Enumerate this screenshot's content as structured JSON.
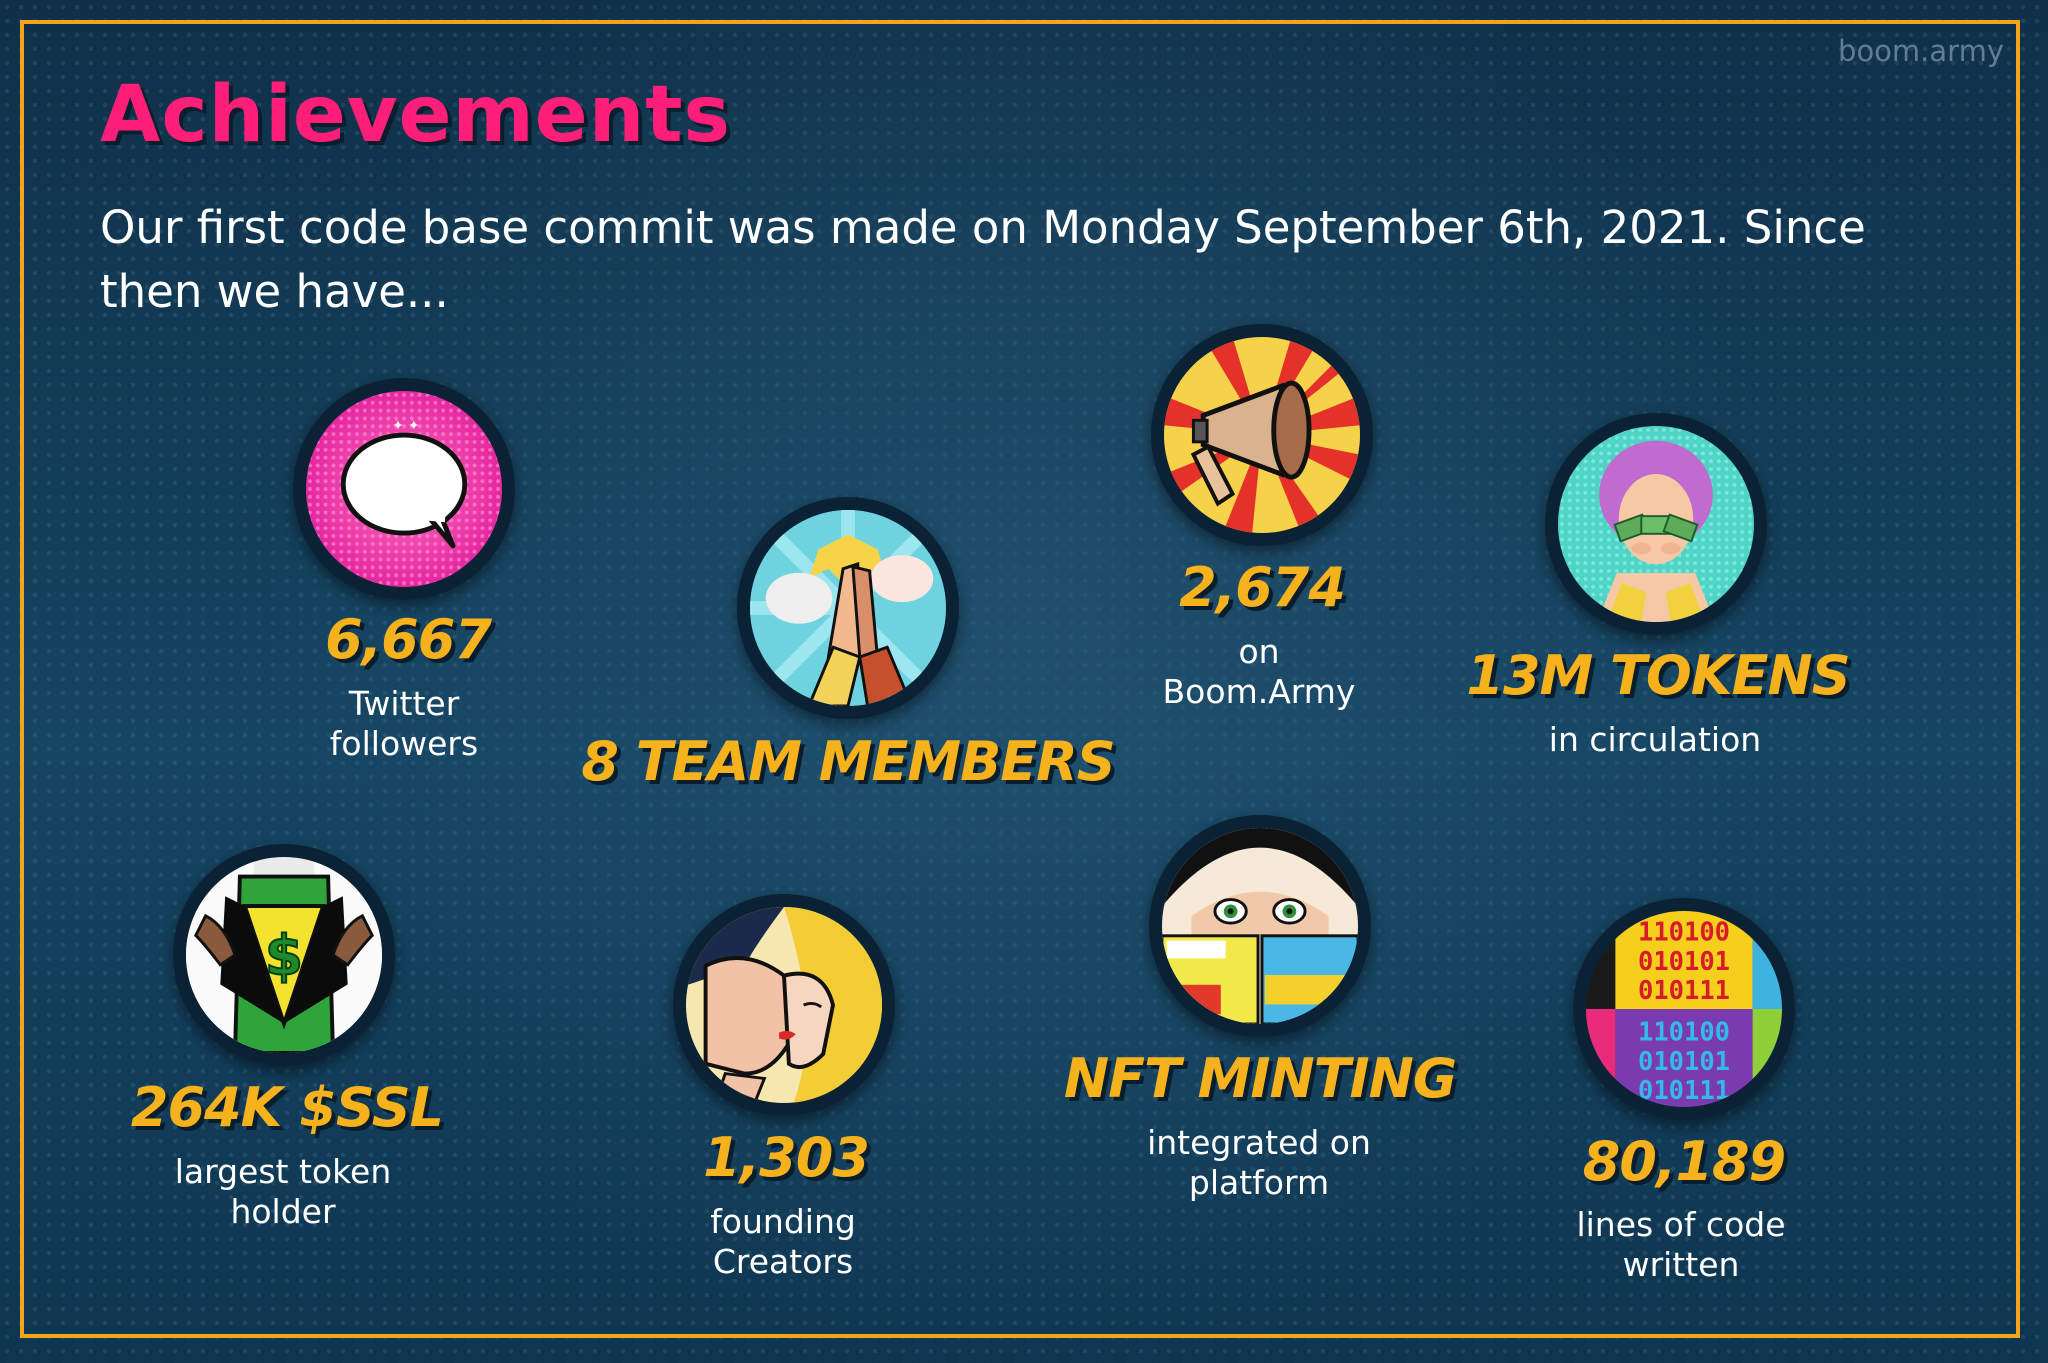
{
  "site": "boom.army",
  "title": "Achievements",
  "intro": "Our first code base commit was made on Monday September 6th, 2021. Since then we have...",
  "colors": {
    "accent_pink": "#ff1f78",
    "accent_gold": "#f6b21d",
    "frame": "#f2a41c",
    "background": "#0e2d44"
  },
  "achievements": [
    {
      "icon": "speech-bubble-icon",
      "value": "6,667",
      "label_1": "Twitter",
      "label_2": "followers"
    },
    {
      "icon": "high-five-icon",
      "value": "8 TEAM MEMBERS"
    },
    {
      "icon": "megaphone-icon",
      "value": "2,674",
      "label_1": "on",
      "label_2": "Boom.Army"
    },
    {
      "icon": "money-woman-icon",
      "value": "13M TOKENS",
      "label_1": "in circulation"
    },
    {
      "icon": "dollar-shirt-icon",
      "value": "264K $SSL",
      "label_1": "largest token",
      "label_2": "holder"
    },
    {
      "icon": "kissing-couple-icon",
      "value": "1,303",
      "label_1": "founding",
      "label_2": "Creators"
    },
    {
      "icon": "comic-reader-icon",
      "value": "NFT MINTING",
      "label_1": "integrated on",
      "label_2": "platform"
    },
    {
      "icon": "binary-code-icon",
      "value": "80,189",
      "label_1": "lines of code",
      "label_2": "written"
    }
  ],
  "binary_text": [
    "110100",
    "010101",
    "010111"
  ]
}
